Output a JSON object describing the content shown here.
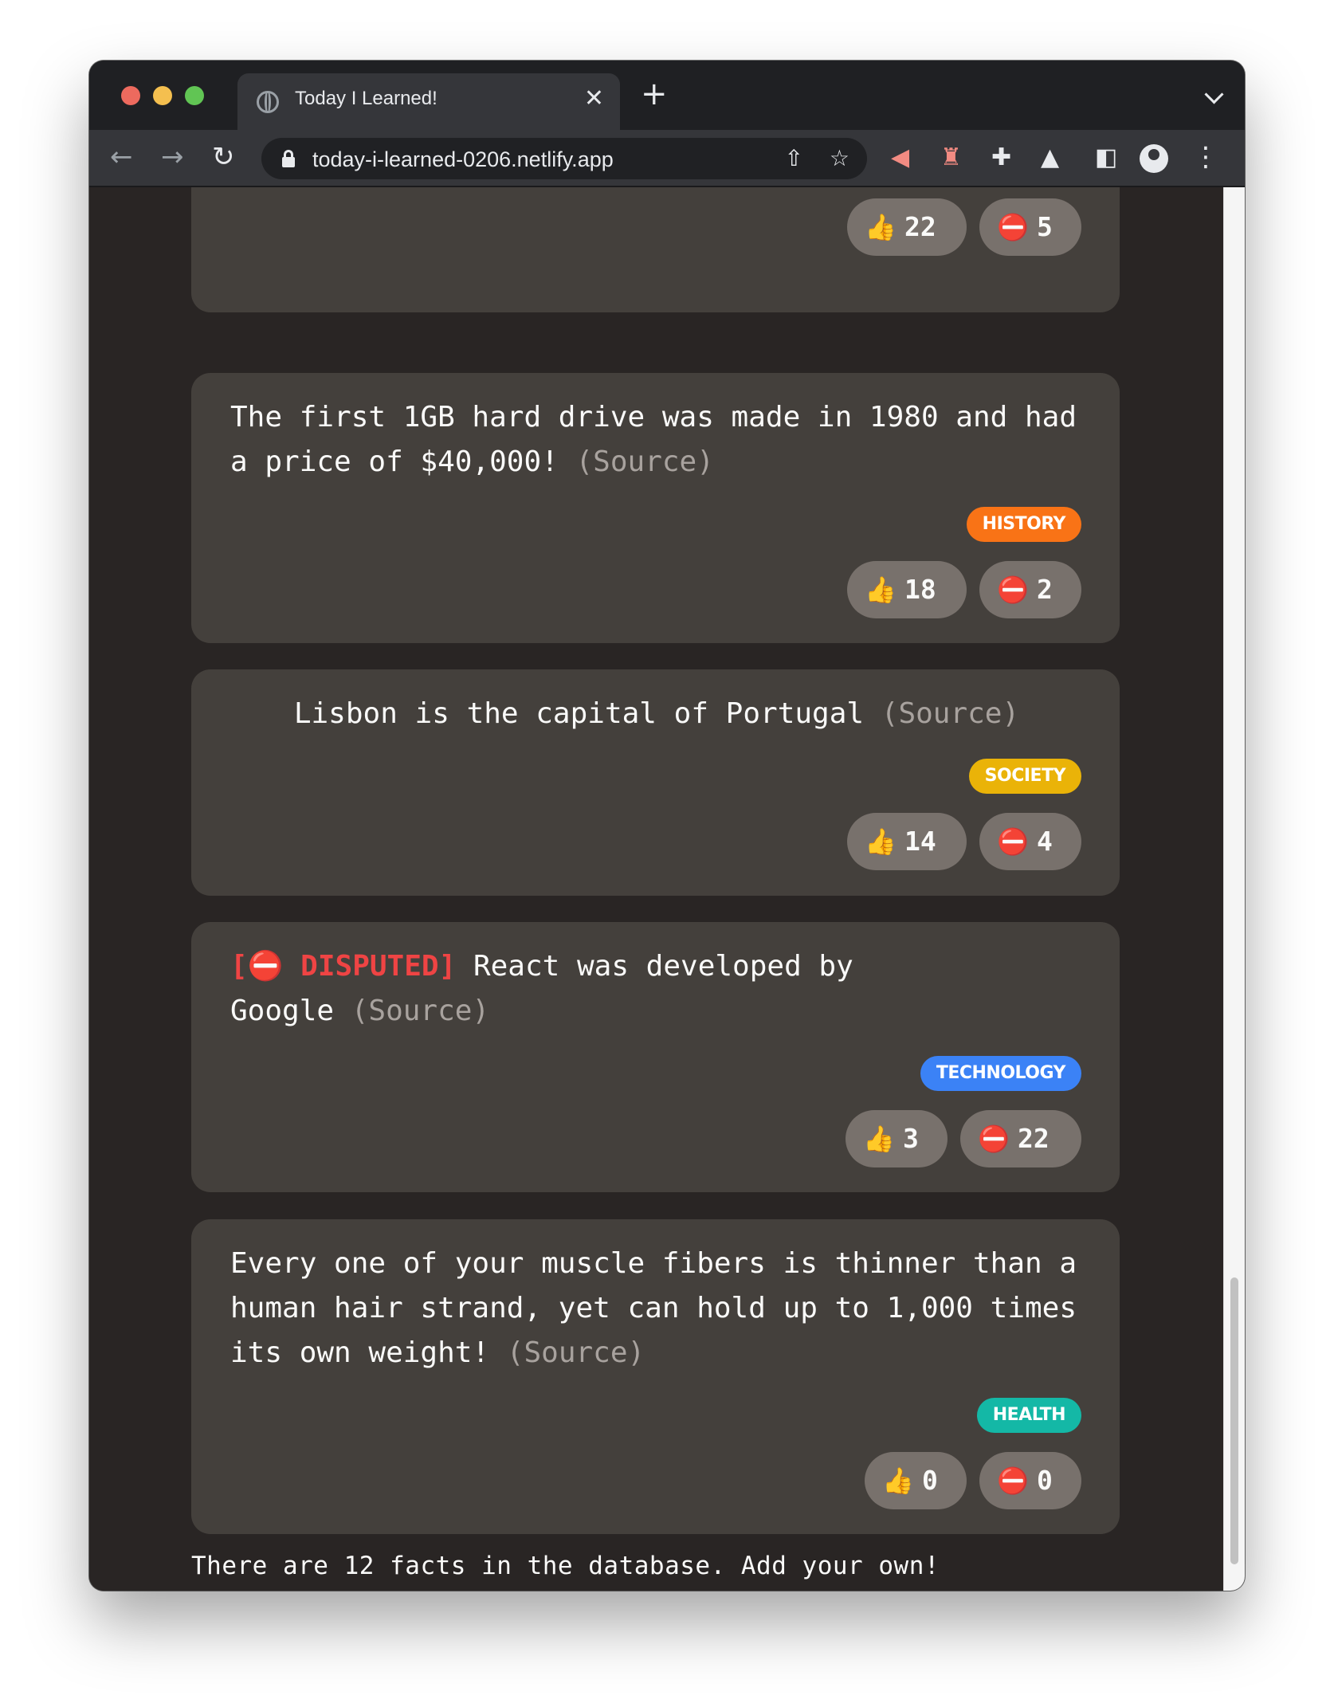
{
  "browser": {
    "tab_title": "Today I Learned!",
    "tab_close": "✕",
    "new_tab": "+",
    "url": "today-i-learned-0206.netlify.app",
    "back_icon": "←",
    "forward_icon": "→",
    "reload_icon": "↻",
    "share_icon": "⇧",
    "star_icon": "☆",
    "kebab_icon": "⋮",
    "ext_video_icon": "◀",
    "ext_lighthouse_icon": "♜",
    "ext_puzzle_icon": "✚",
    "ext_flask_icon": "▲",
    "ext_sidepanel_icon": "◧"
  },
  "vote_icons": {
    "interesting": "👍",
    "false": "⛔"
  },
  "facts": [
    {
      "votes": {
        "interesting": "22",
        "false": "5"
      }
    },
    {
      "text": "The first 1GB hard drive was made in 1980 and had a price of $40,000!",
      "source": "(Source)",
      "tag": "HISTORY",
      "tag_color": "#f97316",
      "votes": {
        "interesting": "18",
        "false": "2"
      }
    },
    {
      "text": "Lisbon is the capital of Portugal",
      "source": "(Source)",
      "tag": "SOCIETY",
      "tag_color": "#eab308",
      "votes": {
        "interesting": "14",
        "false": "4"
      }
    },
    {
      "disputed_label": "[⛔ DISPUTED]",
      "text": "React was developed by Google",
      "source": "(Source)",
      "tag": "TECHNOLOGY",
      "tag_color": "#3b82f6",
      "votes": {
        "interesting": "3",
        "false": "22"
      }
    },
    {
      "text": "Every one of your muscle fibers is thinner than a human hair strand, yet can hold up to 1,000 times its own weight!",
      "source": "(Source)",
      "tag": "HEALTH",
      "tag_color": "#14b8a6",
      "votes": {
        "interesting": "0",
        "false": "0"
      }
    }
  ],
  "footer": "There are 12 facts in the database. Add your own!"
}
